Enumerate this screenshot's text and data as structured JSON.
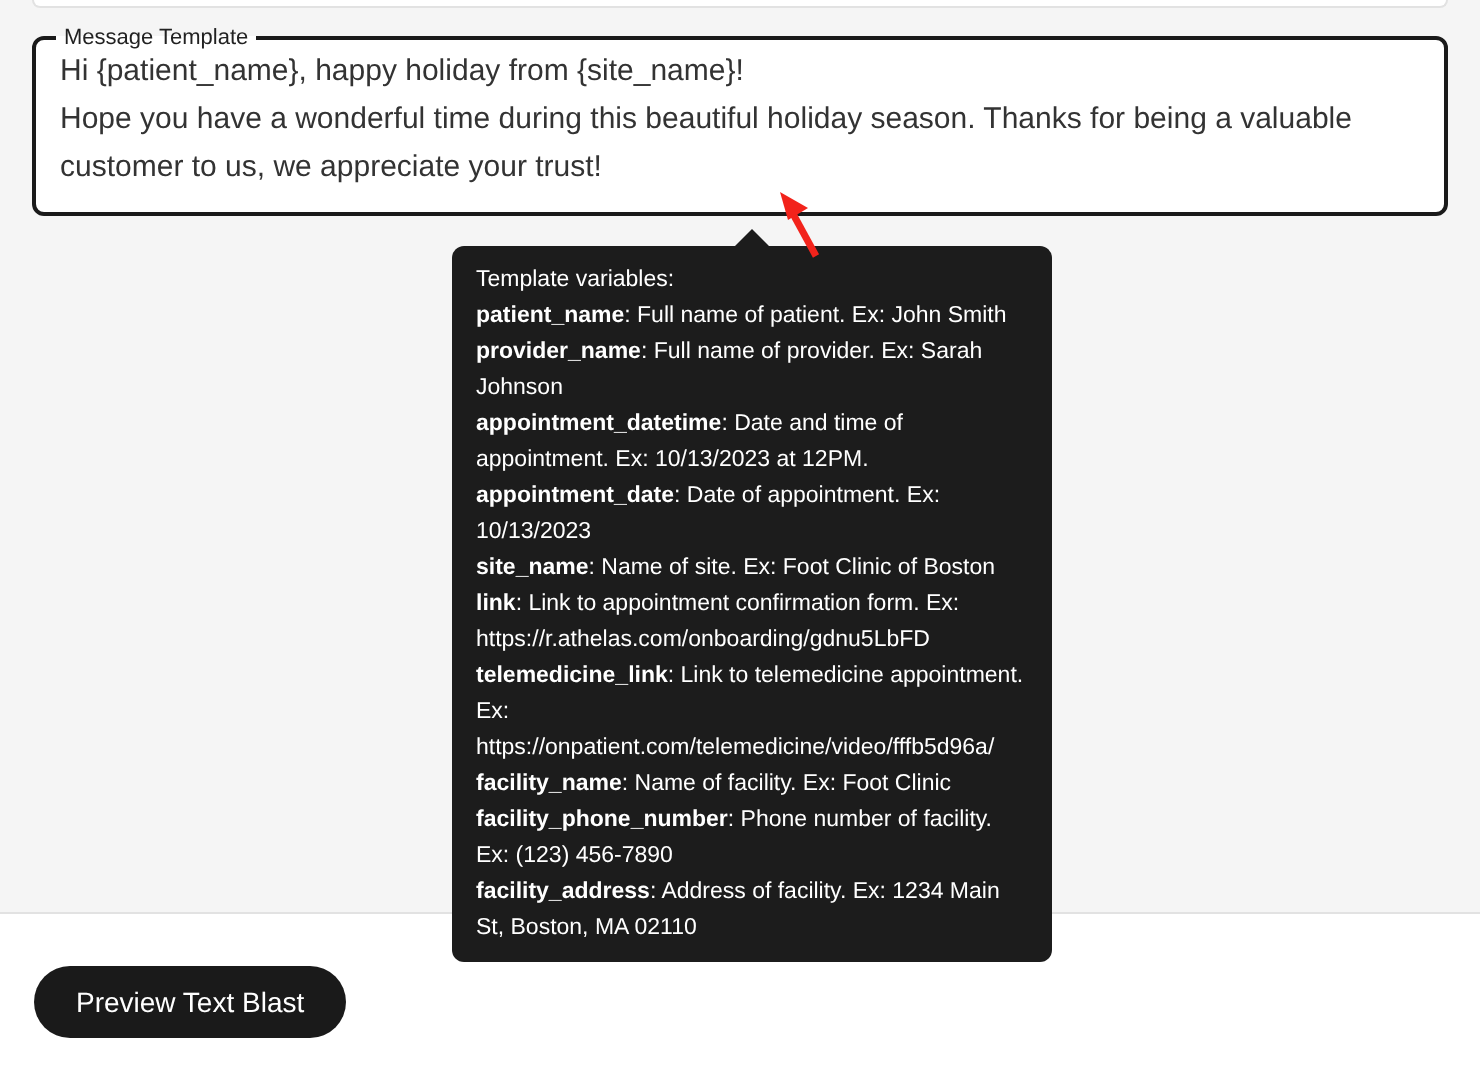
{
  "message_template": {
    "label": "Message Template",
    "value": "Hi {patient_name}, happy holiday from {site_name}!\nHope you have a wonderful time during this beautiful holiday season. Thanks for being a valuable customer to us, we appreciate your trust!"
  },
  "tooltip": {
    "title": "Template variables:",
    "items": [
      "**patient_name**: Full name of patient. Ex: John Smith",
      "**provider_name**: Full name of provider. Ex: Sarah Johnson",
      "**appointment_datetime**: Date and time of appointment. Ex: 10/13/2023 at 12PM.",
      "**appointment_date**: Date of appointment. Ex: 10/13/2023",
      "**site_name**: Name of site. Ex: Foot Clinic of Boston",
      "**link**: Link to appointment confirmation form. Ex: https://r.athelas.com/onboarding/gdnu5LbFD",
      "**telemedicine_link**: Link to telemedicine appointment. Ex: https://onpatient.com/telemedicine/video/fffb5d96a/",
      "**facility_name**: Name of facility. Ex: Foot Clinic",
      "**facility_phone_number**: Phone number of facility. Ex: (123) 456-7890",
      "**facility_address**: Address of facility. Ex: 1234 Main St, Boston, MA 02110"
    ]
  },
  "preview_button": {
    "label": "Preview Text Blast"
  }
}
